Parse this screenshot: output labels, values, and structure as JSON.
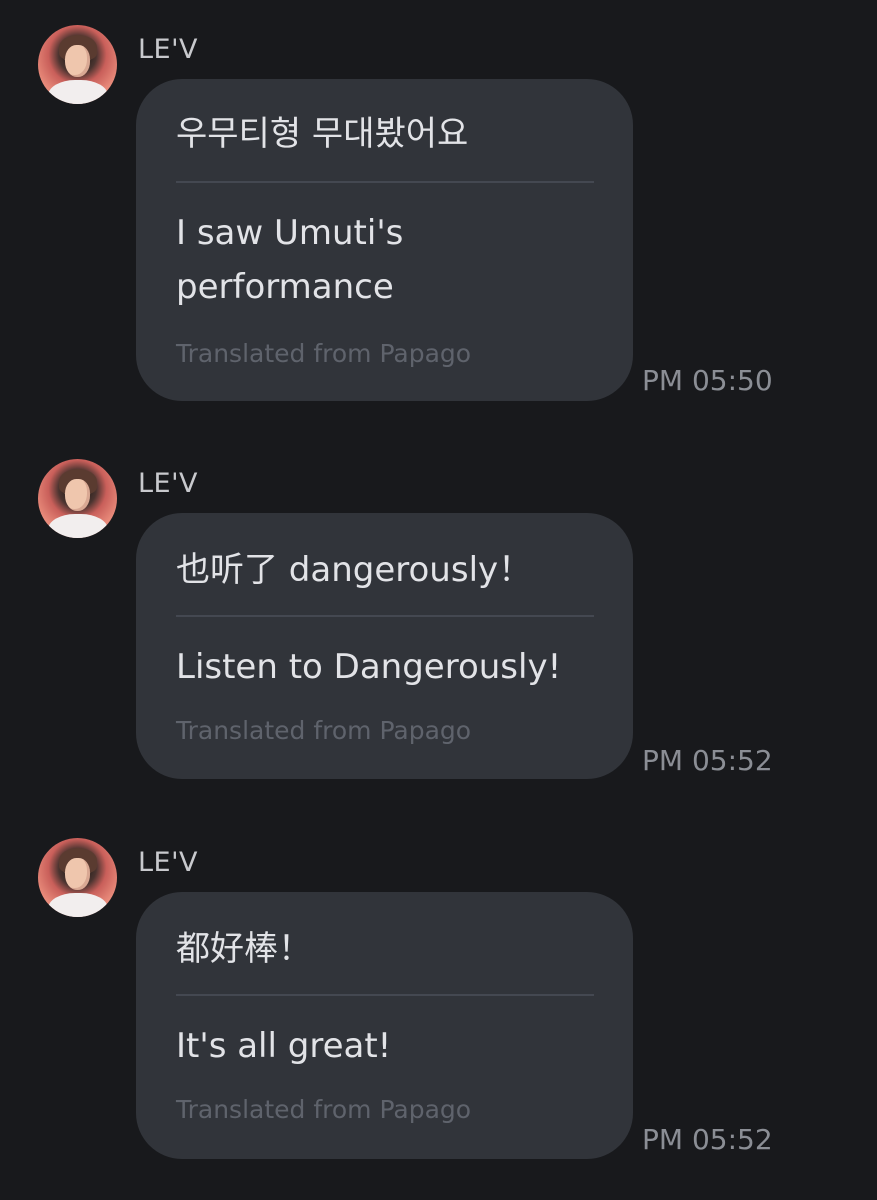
{
  "messages": [
    {
      "sender": "LE'V",
      "original": "우무티형 무대봤어요",
      "translated": "I saw Umuti's performance",
      "credit": "Translated from Papago",
      "time": "PM 05:50"
    },
    {
      "sender": "LE'V",
      "original": "也听了 dangerously！",
      "translated": "Listen to Dangerously!",
      "credit": "Translated from Papago",
      "time": "PM 05:52"
    },
    {
      "sender": "LE'V",
      "original": "都好棒！",
      "translated": "It's all great!",
      "credit": "Translated from Papago",
      "time": "PM 05:52"
    }
  ]
}
